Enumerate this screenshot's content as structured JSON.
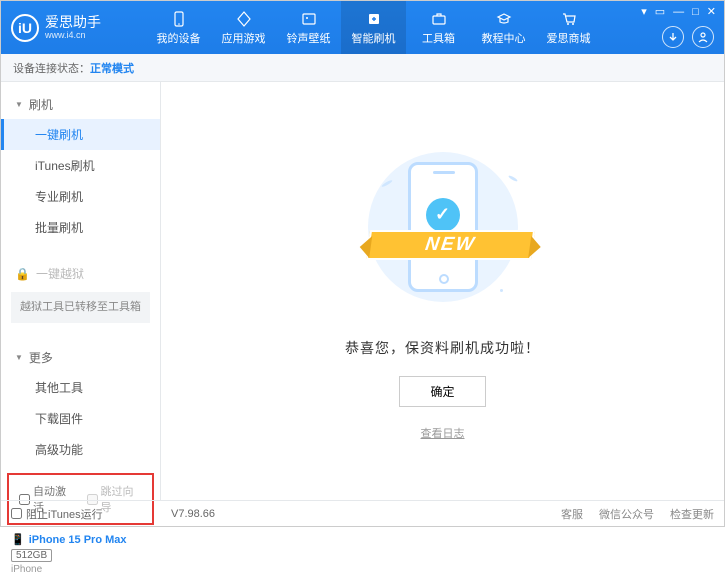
{
  "header": {
    "logo_text": "iU",
    "title": "爱思助手",
    "url": "www.i4.cn",
    "nav": [
      {
        "label": "我的设备"
      },
      {
        "label": "应用游戏"
      },
      {
        "label": "铃声壁纸"
      },
      {
        "label": "智能刷机"
      },
      {
        "label": "工具箱"
      },
      {
        "label": "教程中心"
      },
      {
        "label": "爱思商城"
      }
    ]
  },
  "status": {
    "label": "设备连接状态：",
    "mode": "正常模式"
  },
  "sidebar": {
    "flash_section": "刷机",
    "items": {
      "onekey": "一键刷机",
      "itunes": "iTunes刷机",
      "pro": "专业刷机",
      "batch": "批量刷机"
    },
    "jailbreak_section": "一键越狱",
    "jailbreak_note": "越狱工具已转移至工具箱",
    "more_section": "更多",
    "more_items": {
      "other": "其他工具",
      "download": "下载固件",
      "advanced": "高级功能"
    },
    "checkboxes": {
      "auto_activate": "自动激活",
      "skip_guide": "跳过向导"
    },
    "device": {
      "name": "iPhone 15 Pro Max",
      "storage": "512GB",
      "type": "iPhone"
    }
  },
  "main": {
    "ribbon": "NEW",
    "success": "恭喜您，保资料刷机成功啦！",
    "ok": "确定",
    "log": "查看日志"
  },
  "footer": {
    "block_itunes": "阻止iTunes运行",
    "version": "V7.98.66",
    "links": {
      "service": "客服",
      "wechat": "微信公众号",
      "update": "检查更新"
    }
  }
}
